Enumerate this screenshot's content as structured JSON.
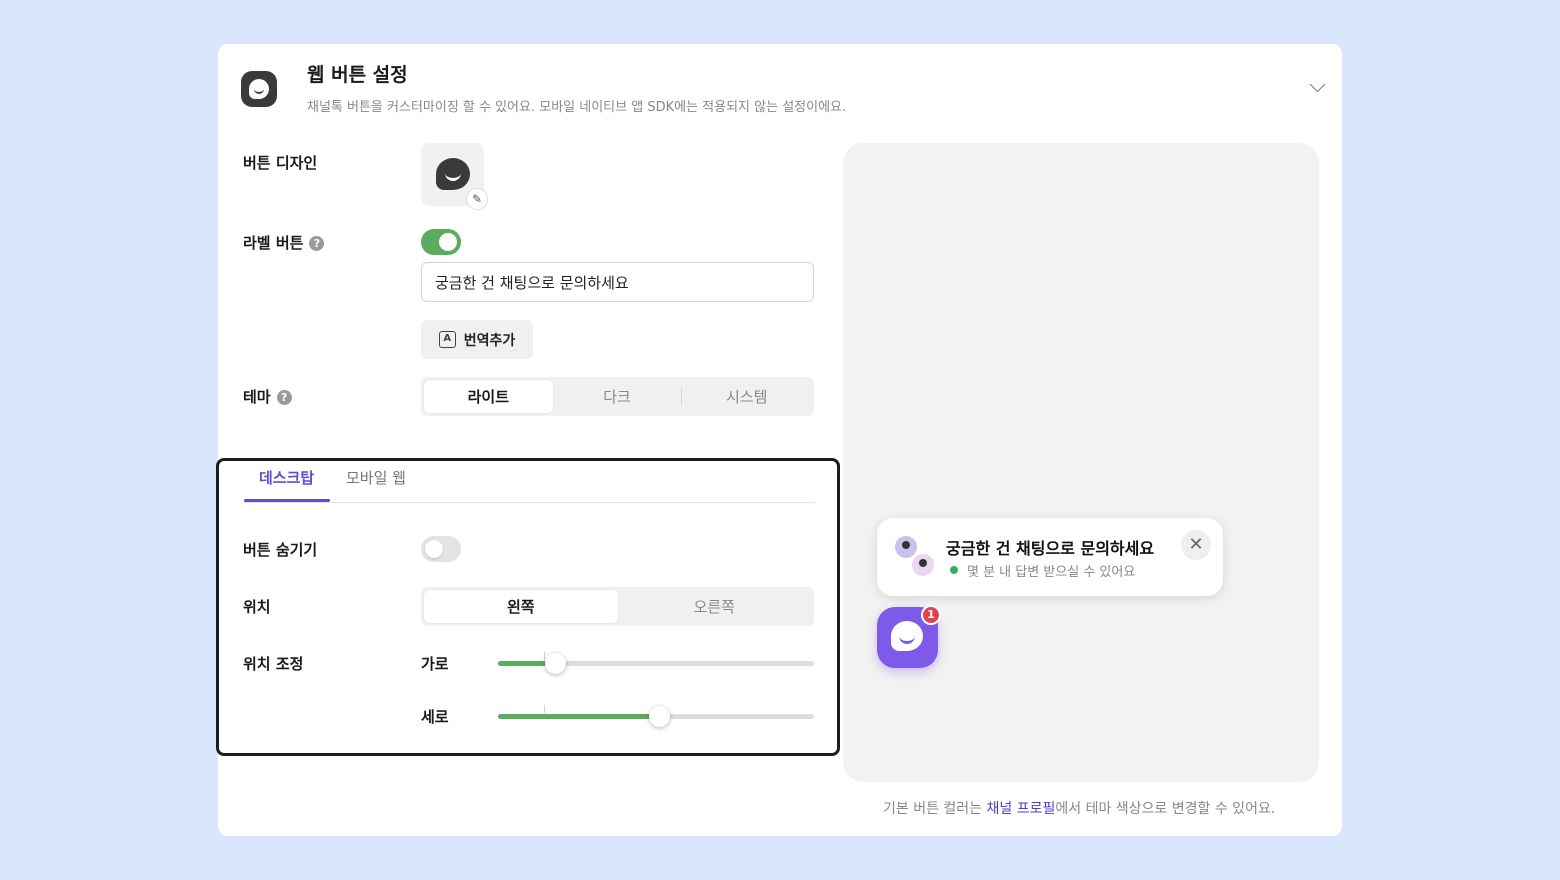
{
  "header": {
    "title": "웹 버튼 설정",
    "subtitle": "채널톡 버튼을 커스터마이징 할 수 있어요. 모바일 네이티브 앱 SDK에는 적용되지 않는 설정이에요."
  },
  "settings": {
    "button_design_label": "버튼 디자인",
    "label_button_label": "라벨 버튼",
    "label_button_enabled": true,
    "label_text_value": "궁금한 건 채팅으로 문의하세요",
    "translate_button": "번역추가",
    "theme_label": "테마",
    "theme_options": [
      "라이트",
      "다크",
      "시스템"
    ],
    "theme_selected": "라이트"
  },
  "tabs": {
    "items": [
      "데스크탑",
      "모바일 웹"
    ],
    "active": "데스크탑"
  },
  "desktop": {
    "hide_button_label": "버튼 숨기기",
    "hide_button_enabled": false,
    "position_label": "위치",
    "position_options": [
      "왼쪽",
      "오른쪽"
    ],
    "position_selected": "왼쪽",
    "position_adjust_label": "위치 조정",
    "horizontal_label": "가로",
    "horizontal_fraction": 0.18,
    "vertical_label": "세로",
    "vertical_fraction": 0.51
  },
  "preview": {
    "popup_title": "궁금한 건 채팅으로 문의하세요",
    "popup_subtitle": "몇 분 내 답변 받으실 수 있어요",
    "badge_count": "1",
    "colors": {
      "button": "#7d5ae8",
      "badge": "#e0434f",
      "online": "#3aae5a"
    }
  },
  "footnote": {
    "before": "기본 버튼 컬러는 ",
    "link": "채널 프로필",
    "after": "에서 테마 색상으로 변경할 수 있어요."
  }
}
